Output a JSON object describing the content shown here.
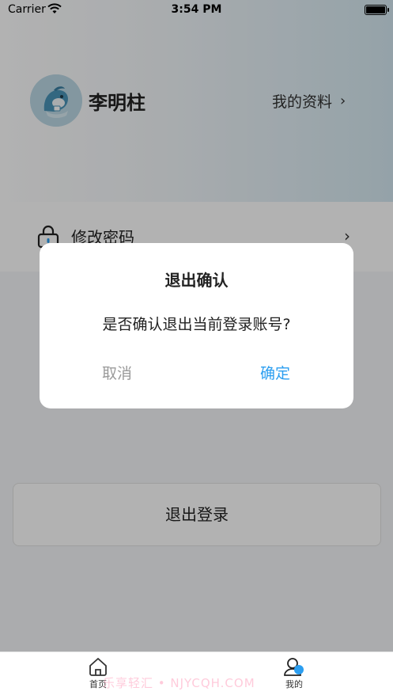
{
  "status_bar": {
    "carrier": "Carrier",
    "time": "3:54 PM"
  },
  "profile": {
    "name": "李明柱",
    "profile_link": "我的资料"
  },
  "menu": {
    "items": [
      {
        "label": "修改密码",
        "icon": "lock-icon"
      }
    ]
  },
  "logout_button": "退出登录",
  "dialog": {
    "title": "退出确认",
    "message": "是否确认退出当前登录账号?",
    "cancel": "取消",
    "confirm": "确定",
    "confirm_color": "#2b9ef0"
  },
  "tabbar": {
    "tabs": [
      {
        "label": "首页",
        "icon": "home-icon"
      },
      {
        "label": "我的",
        "icon": "user-icon"
      }
    ]
  },
  "watermark": "乐享轻汇 • NJYCQH.COM"
}
